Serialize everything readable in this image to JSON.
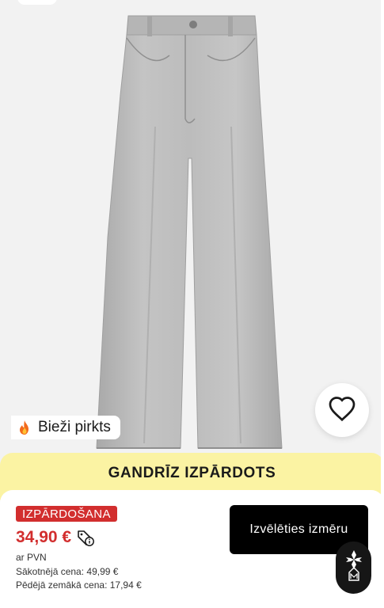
{
  "product": {
    "badge_popular": "Bieži pirkts",
    "banner": "GANDRĪZ IZPĀRDOTS",
    "sale_tag": "IZPĀRDOŠANA",
    "price": "34,90 €",
    "vat_note": "ar PVN",
    "original_price": "Sākotnējā cena: 49,99 €",
    "lowest_price": "Pēdējā zemākā cena: 17,94 €",
    "select_size_label": "Izvēlēties izmēru"
  },
  "icons": {
    "wishlist": "heart-outline-icon",
    "popular": "fire-icon",
    "price_info": "price-tag-info-icon",
    "assistant": "assistant-logo-icon"
  },
  "colors": {
    "sale_red": "#d22e2e",
    "banner_yellow": "#fbf3a3",
    "button_black": "#000000",
    "denim_grey": "#b9b9b9"
  }
}
